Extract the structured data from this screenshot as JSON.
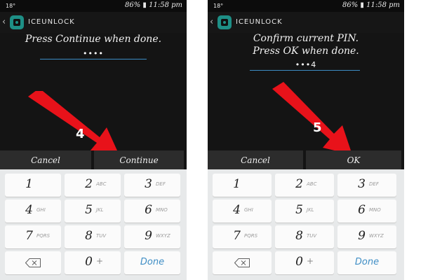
{
  "screens": [
    {
      "status": {
        "left": "18°",
        "right": "86% ▮ 11:58 pm"
      },
      "app_title": "ICEUNLOCK",
      "prompt": "Press Continue when done.",
      "pin_value": "••••",
      "step_number": "4",
      "buttons": {
        "cancel": "Cancel",
        "confirm": "Continue"
      }
    },
    {
      "status": {
        "left": "18°",
        "right": "86% ▮ 11:58 pm"
      },
      "app_title": "ICEUNLOCK",
      "prompt": "Confirm current PIN.\nPress OK when done.",
      "pin_value": "•••4",
      "step_number": "5",
      "buttons": {
        "cancel": "Cancel",
        "confirm": "OK"
      }
    }
  ],
  "keypad": {
    "keys": [
      {
        "digit": "1",
        "letters": ""
      },
      {
        "digit": "2",
        "letters": "ABC"
      },
      {
        "digit": "3",
        "letters": "DEF"
      },
      {
        "digit": "4",
        "letters": "GHI"
      },
      {
        "digit": "5",
        "letters": "JKL"
      },
      {
        "digit": "6",
        "letters": "MNO"
      },
      {
        "digit": "7",
        "letters": "PQRS"
      },
      {
        "digit": "8",
        "letters": "TUV"
      },
      {
        "digit": "9",
        "letters": "WXYZ"
      }
    ],
    "zero": "0",
    "zero_extra": "+",
    "done": "Done"
  },
  "colors": {
    "arrow": "#e8121a",
    "accent": "#3f8ec5",
    "logo": "#1e8f86"
  }
}
